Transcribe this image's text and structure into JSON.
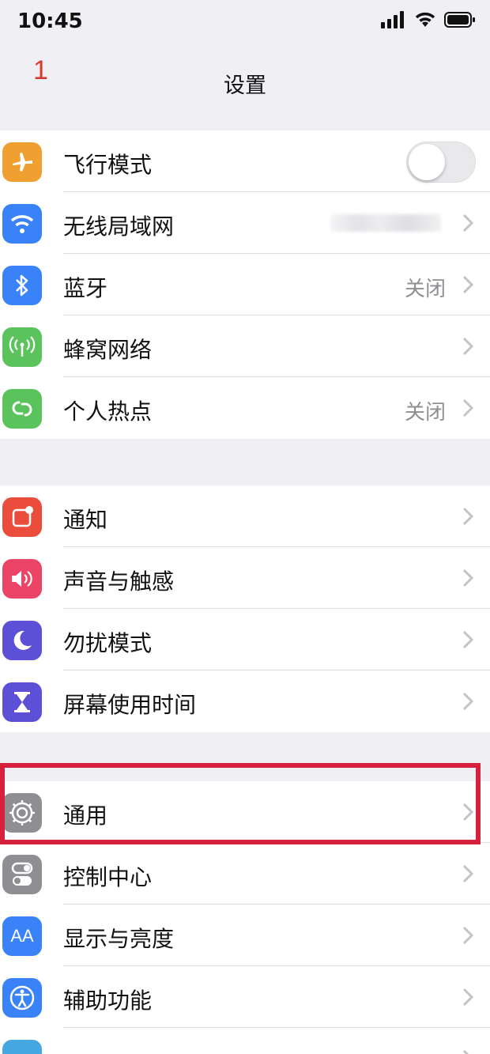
{
  "status_bar": {
    "time": "10:45"
  },
  "annotation": {
    "number": "1"
  },
  "nav": {
    "title": "设置"
  },
  "groups": [
    {
      "items": [
        {
          "label": "飞行模式",
          "icon": "airplane-icon",
          "color": "#f0a030",
          "control": "toggle",
          "toggle_on": false
        },
        {
          "label": "无线局域网",
          "icon": "wifi-icon",
          "color": "#3a82f7",
          "value_blurred": true
        },
        {
          "label": "蓝牙",
          "icon": "bluetooth-icon",
          "color": "#3a82f7",
          "value": "关闭"
        },
        {
          "label": "蜂窝网络",
          "icon": "cellular-icon",
          "color": "#5bc35b"
        },
        {
          "label": "个人热点",
          "icon": "hotspot-icon",
          "color": "#5bc35b",
          "value": "关闭"
        }
      ]
    },
    {
      "items": [
        {
          "label": "通知",
          "icon": "notification-icon",
          "color": "#eb4d3d"
        },
        {
          "label": "声音与触感",
          "icon": "sound-icon",
          "color": "#eb4466"
        },
        {
          "label": "勿扰模式",
          "icon": "moon-icon",
          "color": "#5b50d6"
        },
        {
          "label": "屏幕使用时间",
          "icon": "hourglass-icon",
          "color": "#5b50d6"
        }
      ]
    },
    {
      "items": [
        {
          "label": "通用",
          "icon": "gear-icon",
          "color": "#8e8e93",
          "highlighted": true
        },
        {
          "label": "控制中心",
          "icon": "control-center-icon",
          "color": "#8e8e93"
        },
        {
          "label": "显示与亮度",
          "icon": "display-icon",
          "color": "#3a82f7",
          "icon_text": "AA"
        },
        {
          "label": "辅助功能",
          "icon": "accessibility-icon",
          "color": "#3a82f7"
        }
      ]
    }
  ]
}
